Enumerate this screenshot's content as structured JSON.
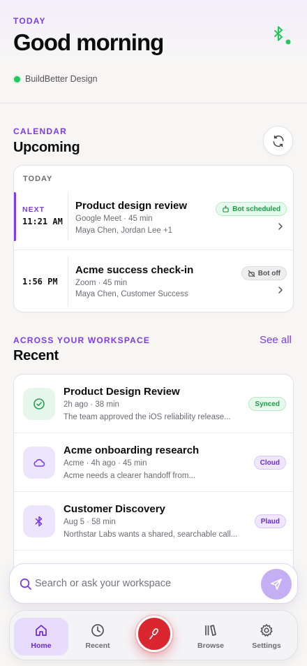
{
  "header": {
    "eyebrow": "TODAY",
    "greeting": "Good morning",
    "workspace": "BuildBetter Design"
  },
  "calendar": {
    "eyebrow": "CALENDAR",
    "title": "Upcoming",
    "day_label": "TODAY",
    "meetings": [
      {
        "tag": "NEXT",
        "time": "11:21 AM",
        "title": "Product design review",
        "meta": "Google Meet · 45 min",
        "people": "Maya Chen, Jordan Lee +1",
        "badge": "Bot scheduled",
        "badge_icon": "bot-icon"
      },
      {
        "time": "1:56 PM",
        "title": "Acme success check-in",
        "meta": "Zoom · 45 min",
        "people": "Maya Chen, Customer Success",
        "badge": "Bot off",
        "badge_icon": "bot-off-icon"
      }
    ]
  },
  "recent": {
    "eyebrow": "ACROSS YOUR WORKSPACE",
    "title": "Recent",
    "see_all": "See all",
    "items": [
      {
        "title": "Product Design Review",
        "meta": "2h ago · 38 min",
        "desc": "The team approved the iOS reliability release...",
        "badge": "Synced",
        "icon": "check-circle-icon"
      },
      {
        "title": "Acme onboarding research",
        "meta": "Acme · 4h ago · 45 min",
        "desc": "Acme needs a clearer handoff from...",
        "badge": "Cloud",
        "icon": "cloud-icon"
      },
      {
        "title": "Customer Discovery",
        "meta": "Aug 5 · 58 min",
        "desc": "Northstar Labs wants a shared, searchable call...",
        "badge": "Plaud",
        "icon": "bluetooth-icon"
      }
    ]
  },
  "search": {
    "placeholder": "Search or ask your workspace"
  },
  "nav": {
    "home": "Home",
    "recent": "Recent",
    "browse": "Browse",
    "settings": "Settings"
  },
  "colors": {
    "accent": "#7c3aed",
    "success": "#22c55e",
    "record": "#d9262f"
  }
}
